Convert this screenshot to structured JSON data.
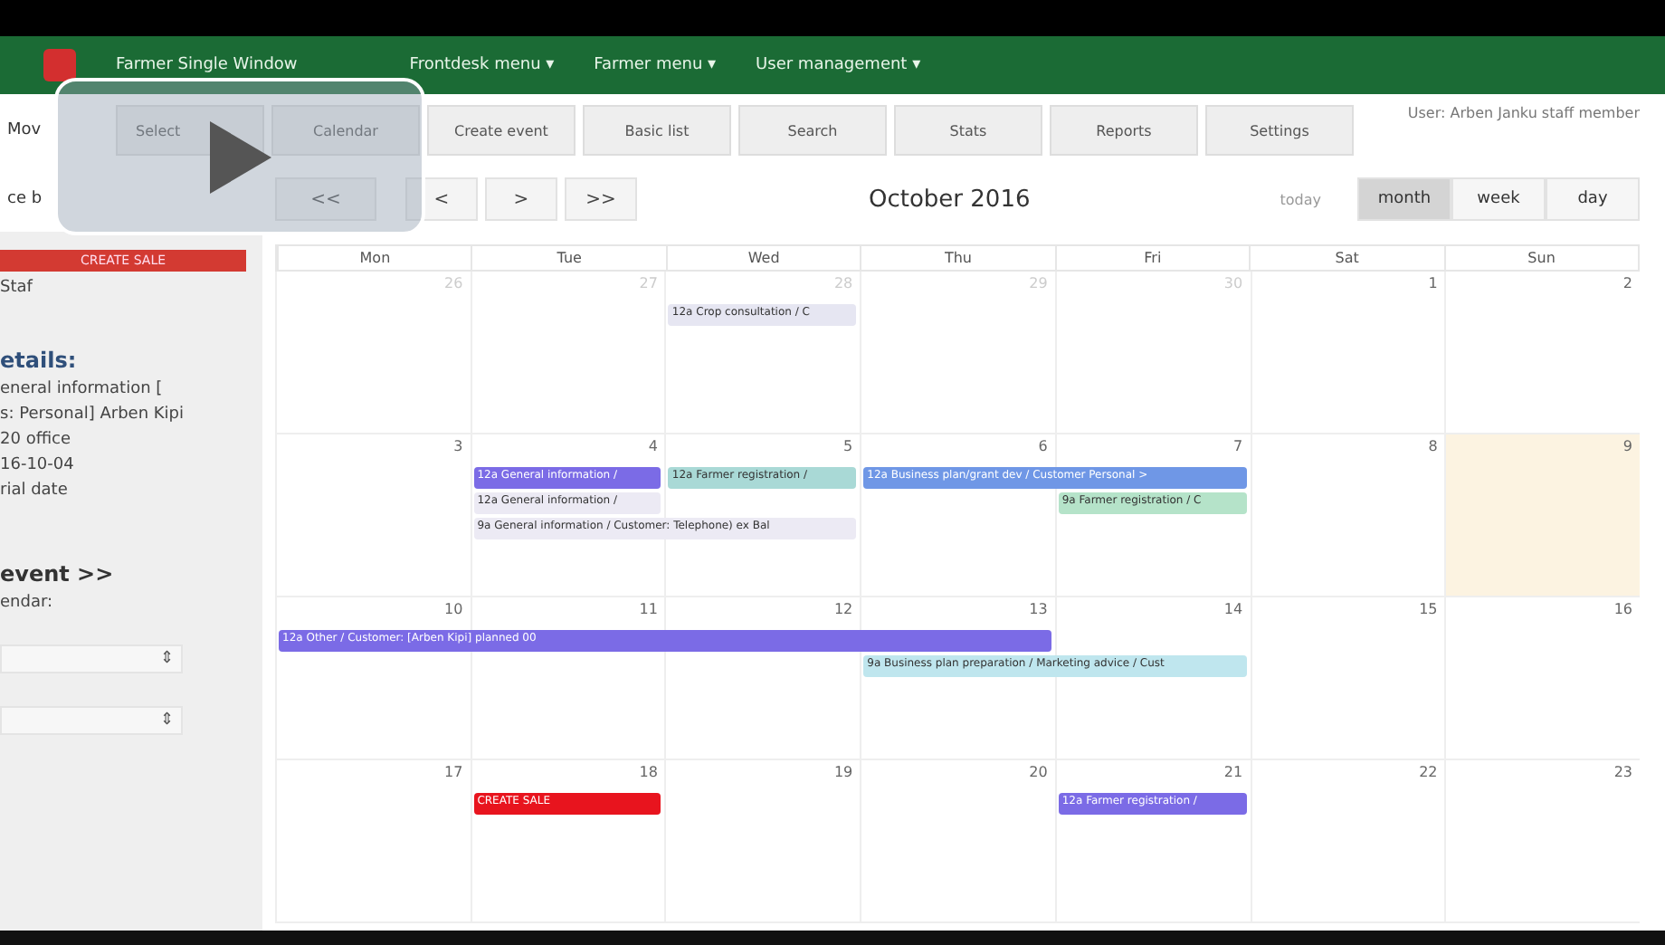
{
  "topnav": {
    "title": "Farmer Single Window",
    "menus": [
      "Frontdesk menu ▾",
      "Farmer menu ▾",
      "User management ▾"
    ]
  },
  "toolbar": {
    "left_label": "Mov",
    "buttons": [
      "Select",
      "Calendar",
      "Create event",
      "Basic list",
      "Search",
      "Stats",
      "Reports",
      "Settings"
    ],
    "user": "User: Arben Janku staff member"
  },
  "nav": {
    "left_label": "ce b",
    "prev_year": "<<",
    "prev": "<",
    "next": ">",
    "next_year": ">>",
    "title": "October 2016",
    "today": "today",
    "views": [
      {
        "label": "month",
        "selected": true
      },
      {
        "label": "week",
        "selected": false
      },
      {
        "label": "day",
        "selected": false
      }
    ]
  },
  "sidebar": {
    "sale_button": "CREATE SALE",
    "staff": "Staf",
    "details_heading": "etails:",
    "details": [
      "eneral information [",
      "s: Personal] Arben Kipi",
      "20 office",
      "16-10-04",
      "rial date"
    ],
    "event_heading": "event >>",
    "calendar_label": "endar:",
    "selects": [
      {
        "arrows": "⇕"
      },
      {
        "arrows": "⇕"
      }
    ]
  },
  "calendar": {
    "play": true,
    "weekdays": [
      "Mon",
      "Tue",
      "Wed",
      "Thu",
      "Fri",
      "Sat",
      "Sun"
    ],
    "weeks": [
      {
        "days": [
          {
            "num": "26",
            "other": true,
            "today": false
          },
          {
            "num": "27",
            "other": true,
            "today": false
          },
          {
            "num": "28",
            "other": true,
            "today": false,
            "slots": [
              {
                "kind": "event",
                "label": "12a Crop consultation / C",
                "color": "#e6e6f2"
              }
            ]
          },
          {
            "num": "29",
            "other": true,
            "today": false
          },
          {
            "num": "30",
            "other": true,
            "today": false
          },
          {
            "num": "1",
            "other": false,
            "today": false
          },
          {
            "num": "2",
            "other": false,
            "today": false
          }
        ]
      },
      {
        "days": [
          {
            "num": "3",
            "other": false,
            "today": false
          },
          {
            "num": "4",
            "other": false,
            "today": false,
            "slots": [
              {
                "kind": "event",
                "label": "12a General information /",
                "color": "#7b6be6"
              },
              {
                "kind": "event",
                "label": "12a General information /",
                "color": "#eceaf4"
              },
              {
                "kind": "event",
                "label": "9a General information / Customer: Telephone) ex Bal",
                "color": "#eceaf4"
              }
            ]
          },
          {
            "num": "5",
            "other": false,
            "today": false,
            "slots": [
              {
                "kind": "event",
                "label": "12a Farmer registration /",
                "color": "#a9d9d6"
              },
              {
                "kind": "gap"
              },
              {
                "kind": "continued"
              }
            ]
          },
          {
            "num": "6",
            "other": false,
            "today": false,
            "slots": [
              {
                "kind": "event",
                "label": "12a Business plan/grant dev / Customer Personal >",
                "color": "#6f97e6"
              }
            ]
          },
          {
            "num": "7",
            "other": false,
            "today": false,
            "slots": [
              {
                "kind": "continued"
              },
              {
                "kind": "event",
                "label": "9a Farmer registration / C",
                "color": "#b5e3c9"
              }
            ]
          },
          {
            "num": "8",
            "other": false,
            "today": false
          },
          {
            "num": "9",
            "other": false,
            "today": true
          }
        ]
      },
      {
        "days": [
          {
            "num": "10",
            "other": false,
            "today": false,
            "slots": [
              {
                "kind": "event",
                "label": "12a Other / Customer: [Arben Kipi] planned 00",
                "color": "#7b6be6"
              }
            ]
          },
          {
            "num": "11",
            "other": false,
            "today": false,
            "slots": [
              {
                "kind": "continued"
              }
            ]
          },
          {
            "num": "12",
            "other": false,
            "today": false,
            "slots": [
              {
                "kind": "continued"
              }
            ]
          },
          {
            "num": "13",
            "other": false,
            "today": false,
            "slots": [
              {
                "kind": "continued"
              },
              {
                "kind": "event",
                "label": "9a Business plan preparation / Marketing advice / Cust",
                "color": "#bfe6ee"
              }
            ]
          },
          {
            "num": "14",
            "other": false,
            "today": false,
            "slots": [
              {
                "kind": "gap"
              },
              {
                "kind": "continued"
              }
            ]
          },
          {
            "num": "15",
            "other": false,
            "today": false
          },
          {
            "num": "16",
            "other": false,
            "today": false
          }
        ]
      },
      {
        "days": [
          {
            "num": "17",
            "other": false,
            "today": false
          },
          {
            "num": "18",
            "other": false,
            "today": false,
            "slots": [
              {
                "kind": "event",
                "label": "CREATE SALE",
                "color": "#e8141e"
              }
            ]
          },
          {
            "num": "19",
            "other": false,
            "today": false
          },
          {
            "num": "20",
            "other": false,
            "today": false
          },
          {
            "num": "21",
            "other": false,
            "today": false,
            "slots": [
              {
                "kind": "event",
                "label": "12a Farmer registration /",
                "color": "#7b6be6"
              }
            ]
          },
          {
            "num": "22",
            "other": false,
            "today": false
          },
          {
            "num": "23",
            "other": false,
            "today": false
          }
        ]
      }
    ]
  }
}
